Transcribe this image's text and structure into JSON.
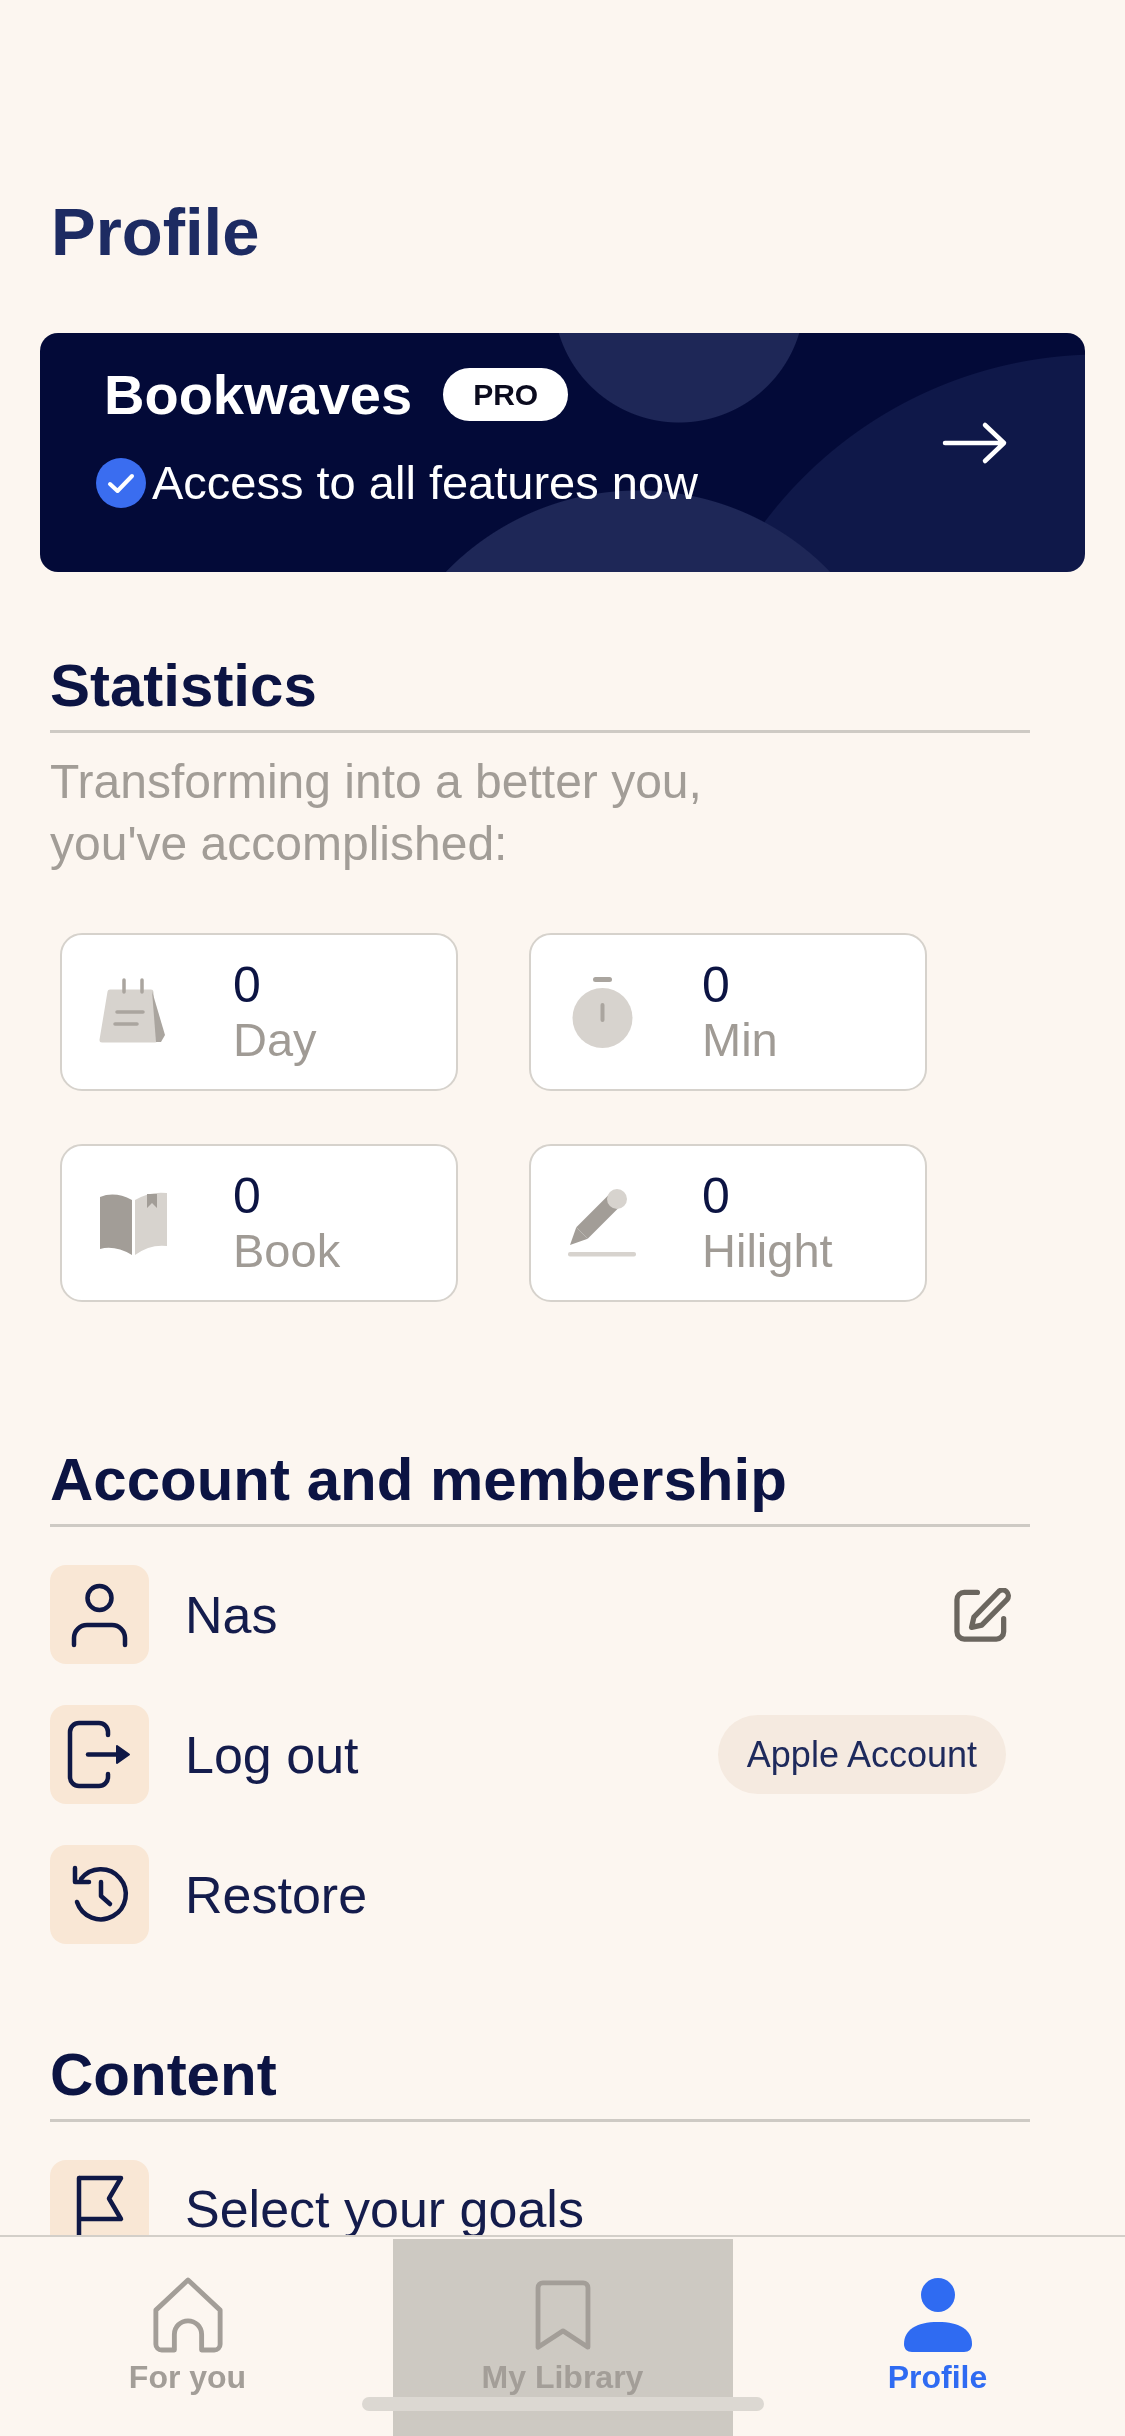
{
  "header": {
    "title": "Profile"
  },
  "banner": {
    "title": "Bookwaves",
    "badge": "PRO",
    "subtitle": "Access to all features now"
  },
  "statistics": {
    "title": "Statistics",
    "subtitle": "Transforming into a better you,\nyou've accomplished:",
    "stats": [
      {
        "value": "0",
        "label": "Day"
      },
      {
        "value": "0",
        "label": "Min"
      },
      {
        "value": "0",
        "label": "Book"
      },
      {
        "value": "0",
        "label": "Hilight"
      }
    ]
  },
  "account": {
    "title": "Account and membership",
    "items": [
      {
        "label": "Nas",
        "kind": "editable"
      },
      {
        "label": "Log out",
        "kind": "badge",
        "badge": "Apple Account"
      },
      {
        "label": "Restore",
        "kind": "plain"
      }
    ]
  },
  "content": {
    "title": "Content",
    "items": [
      {
        "label": "Select your goals"
      }
    ]
  },
  "tabs": [
    {
      "label": "For you",
      "selected": false,
      "pressed": false
    },
    {
      "label": "My Library",
      "selected": false,
      "pressed": true
    },
    {
      "label": "Profile",
      "selected": true,
      "pressed": false
    }
  ]
}
